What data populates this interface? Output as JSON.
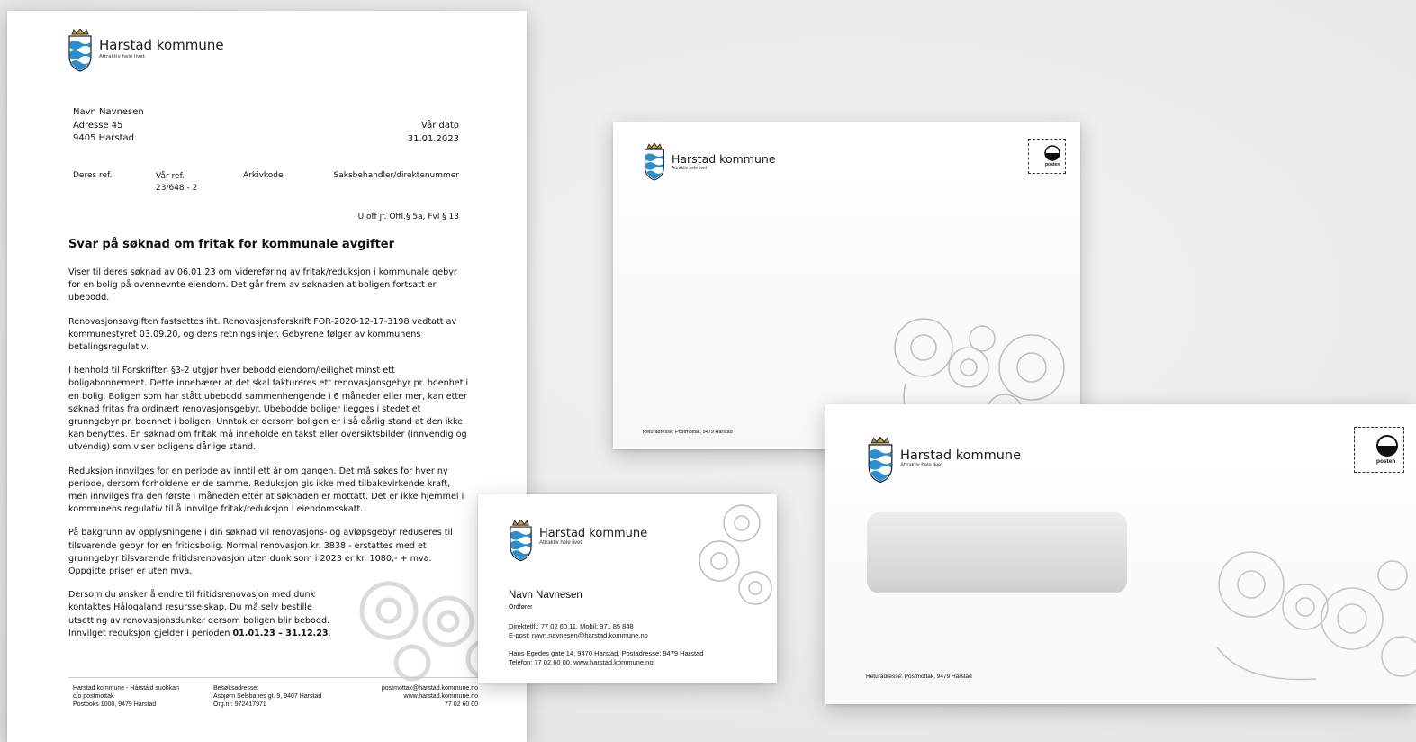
{
  "brand": {
    "name": "Harstad kommune",
    "tagline": "Attraktiv hele livet",
    "colors": {
      "shield_blue": "#2a8fd0",
      "crown_gold": "#c9a227",
      "stroke": "#222222"
    }
  },
  "letter": {
    "recipient": {
      "name": "Navn Navnesen",
      "address": "Adresse 45",
      "postal": "9405 Harstad"
    },
    "date_label": "Vår dato",
    "date_value": "31.01.2023",
    "refs": {
      "deres_ref_label": "Deres ref.",
      "var_ref_label": "Vår ref.",
      "var_ref_value": "23/648 - 2",
      "arkivkode_label": "Arkivkode",
      "saksbehandler_label": "Saksbehandler/direktenummer"
    },
    "uoff": "U.off jf. Offl.§ 5a, Fvl § 13",
    "title": "Svar på søknad om fritak for kommunale avgifter",
    "paragraphs": [
      "Viser til deres søknad av 06.01.23 om videreføring av fritak/reduksjon i kommunale gebyr for en bolig på ovennevnte eiendom. Det går frem av søknaden at boligen fortsatt er ubebodd.",
      "Renovasjonsavgiften fastsettes iht. Renovasjonsforskrift FOR-2020-12-17-3198 vedtatt av kommunestyret 03.09.20, og dens retningslinjer. Gebyrene følger av kommunens betalingsregulativ.",
      "I henhold til Forskriften §3-2 utgjør hver bebodd eiendom/leilighet minst ett boligabonnement. Dette innebærer at det skal faktureres ett renovasjonsgebyr pr. boenhet i en bolig. Boligen som har stått ubebodd sammenhengende i 6 måneder eller mer, kan etter søknad fritas fra ordinært renovasjonsgebyr. Ubebodde boliger ilegges i stedet et grunngebyr pr. boenhet i boligen. Unntak er dersom boligen er i så dårlig stand at den ikke kan benyttes. En søknad om fritak må inneholde en takst eller oversiktsbilder (innvendig og utvendig) som viser boligens dårlige stand.",
      "Reduksjon innvilges for en periode av inntil ett år om gangen. Det må søkes for hver ny periode, dersom forholdene er de samme. Reduksjon gis ikke med tilbakevirkende kraft, men innvilges fra den første i måneden etter at søknaden er mottatt. Det er ikke hjemmel i kommunens regulativ til å innvilge fritak/reduksjon i eiendomsskatt.",
      "På bakgrunn av opplysningene i din søknad vil renovasjons- og avløpsgebyr reduseres til tilsvarende gebyr for en fritidsbolig. Normal renovasjon kr. 3838,- erstattes med et grunngebyr tilsvarende fritidsrenovasjon uten dunk som i 2023 er kr. 1080,- + mva. Oppgitte priser er uten mva.",
      "Dersom du ønsker å endre til fritidsrenovasjon med dunk kontaktes Hålogaland resursselskap. Du må selv bestille utsetting av renovasjonsdunker dersom boligen blir bebodd."
    ],
    "last_line_prefix": "Innvilget reduksjon gjelder i perioden ",
    "last_line_period": "01.01.23 – 31.12.23",
    "last_line_suffix": ".",
    "footer": {
      "col1": [
        "Harstad kommune - Hárstáid suohkan",
        "c/o postmottak",
        "Postboks 1000, 9479 Harstad"
      ],
      "col2": [
        "Besøksadresse:",
        "Asbjørn Selsbanes gt. 9, 9407 Harstad",
        "Org.nr: 972417971"
      ],
      "col3": [
        "postmottak@harstad.kommune.no",
        "www.harstad.kommune.no",
        "77 02 60 00"
      ]
    }
  },
  "envelope_small": {
    "return_address": "Returadresse: Postmottak, 9479 Harstad",
    "stamp_label": "posten"
  },
  "envelope_large": {
    "return_address": "Returadresse: Postmottak, 9479 Harstad",
    "stamp_label": "posten"
  },
  "business_card": {
    "name": "Navn Navnesen",
    "role": "Ordfører",
    "phone": "Direktetlf.: 77 02 60 11, Mobil: 971 85 848",
    "email": "E-post: navn.navnesen@harstad.kommune.no",
    "address": "Hans Egedes gate 14, 9470 Harstad, Postadresse: 9479 Harstad",
    "phone_web": "Telefon: 77 02 60 00, www.harstad.kommune.no"
  }
}
